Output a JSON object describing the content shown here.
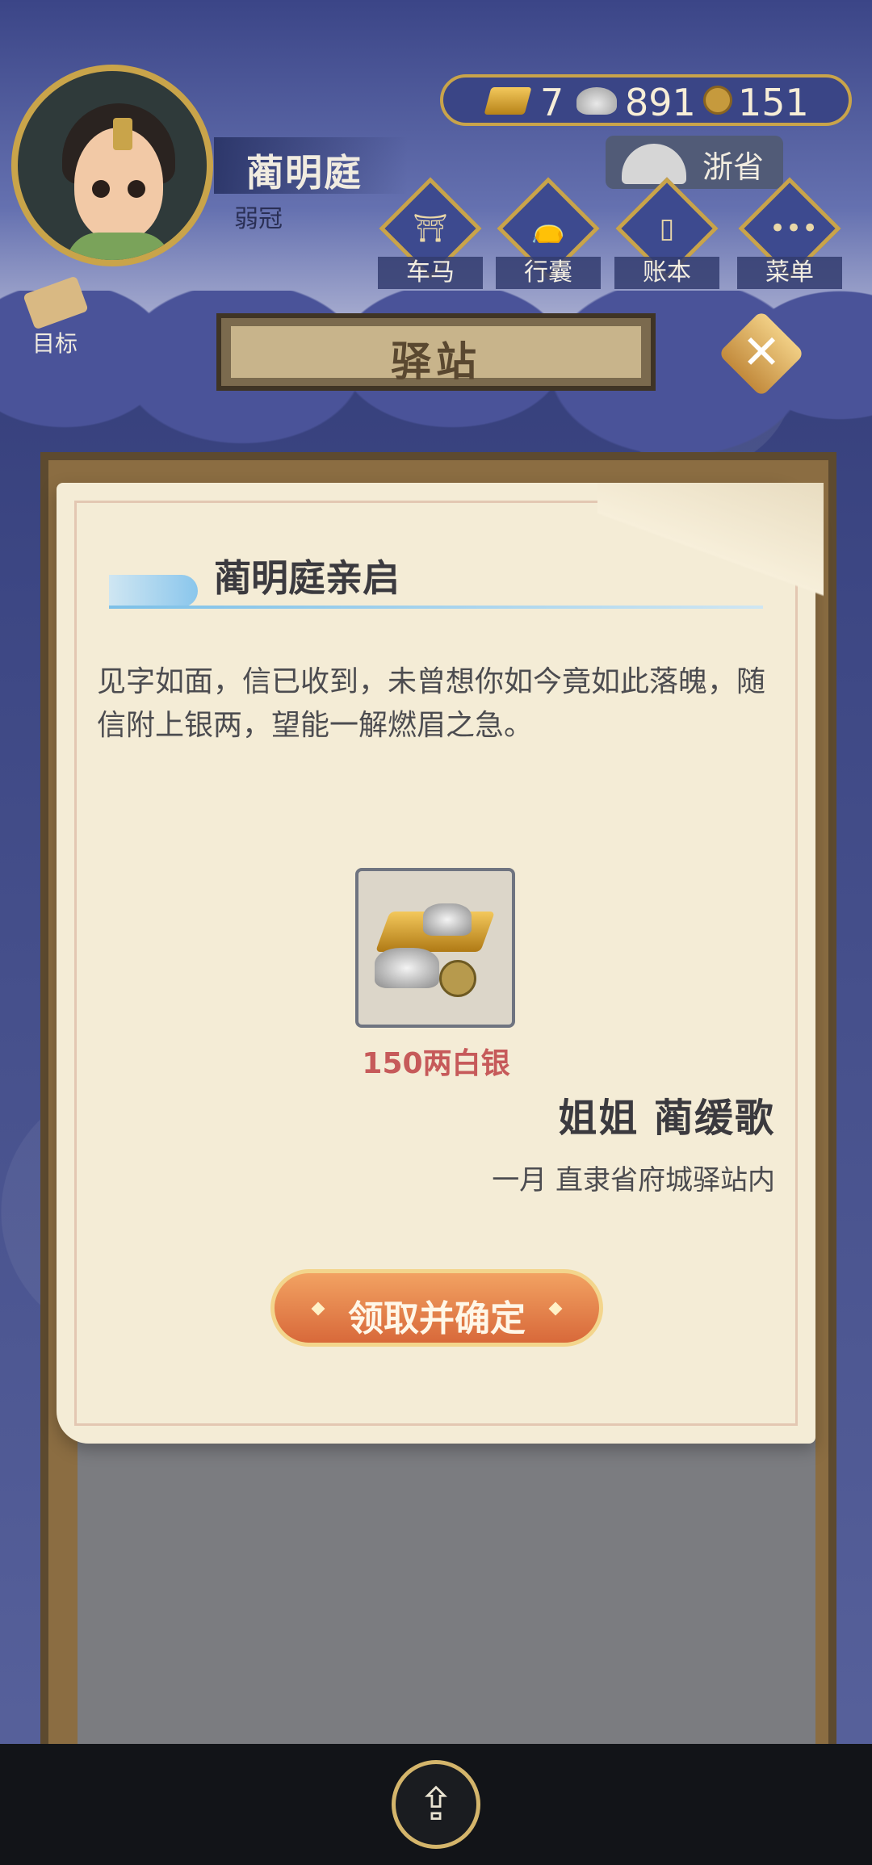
{
  "player": {
    "name": "蔺明庭",
    "age_title": "弱冠"
  },
  "currency": {
    "gold": "7",
    "silver": "891",
    "coins": "151"
  },
  "province": "浙省",
  "menu": [
    {
      "label": "车马",
      "icon": "carriage-icon"
    },
    {
      "label": "行囊",
      "icon": "bag-icon"
    },
    {
      "label": "账本",
      "icon": "ledger-icon"
    },
    {
      "label": "菜单",
      "icon": "more-icon"
    }
  ],
  "goal": {
    "label": "目标",
    "icon": "scroll-icon"
  },
  "page_title": "驿站",
  "letter": {
    "heading": "蔺明庭亲启",
    "body": "见字如面，信已收到，未曾想你如今竟如此落魄，随信附上银两，望能一解燃眉之急。",
    "item": {
      "label": "150两白银",
      "icon": "silver-ingots-icon"
    },
    "sender": "姐姐 蔺缓歌",
    "date_location": "一月 直隶省府城驿站内",
    "confirm_label": "领取并确定"
  },
  "colors": {
    "accent_gold": "#c9a44a",
    "button_orange": "#d8693a",
    "reward_red": "#c65a5a"
  }
}
